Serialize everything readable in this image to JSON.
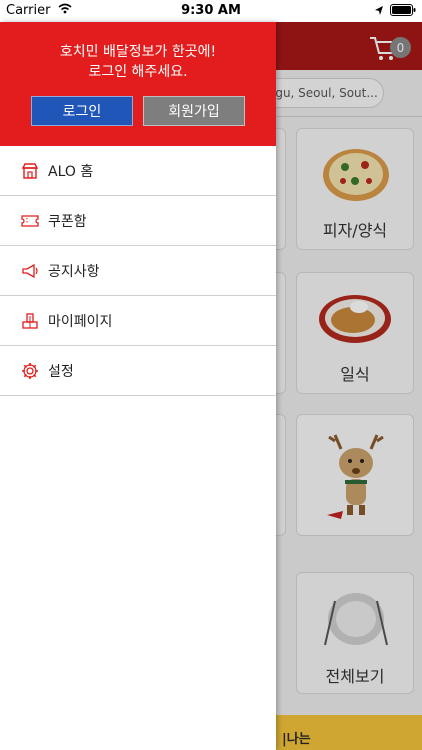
{
  "status_bar": {
    "carrier": "Carrier",
    "time": "9:30 AM"
  },
  "background": {
    "cart_count": "0",
    "address": "-gu, Seoul, Sout...",
    "tiles": [
      {
        "label": "피자/양식"
      },
      {
        "label": "일식"
      },
      {
        "label": ""
      },
      {
        "label": "전체보기"
      }
    ],
    "banner_text": "|나는"
  },
  "drawer": {
    "message_line1": "호치민 배달정보가 한곳에!",
    "message_line2": "로그인 해주세요.",
    "login_label": "로그인",
    "signup_label": "회원가입",
    "menu": [
      {
        "label": "ALO 홈",
        "icon": "store-icon"
      },
      {
        "label": "쿠폰함",
        "icon": "coupon-icon"
      },
      {
        "label": "공지사항",
        "icon": "megaphone-icon"
      },
      {
        "label": "마이페이지",
        "icon": "mypage-icon"
      },
      {
        "label": "설정",
        "icon": "gear-icon"
      }
    ]
  },
  "colors": {
    "drawer_header": "#e31d1d",
    "login_button": "#1f56b8",
    "signup_button": "#7e7e7e",
    "icon_red": "#e31d1d"
  }
}
